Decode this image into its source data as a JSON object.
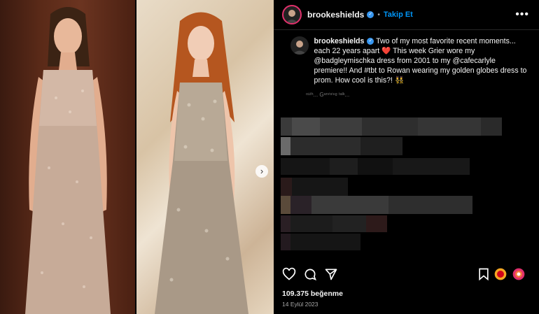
{
  "post": {
    "username": "brookeshields",
    "separator": "•",
    "follow_label": "Takip Et",
    "more_label": "•••",
    "caption_user": "brookeshields",
    "caption_line1": "Two of my most favorite recent moments... each 22 years apart",
    "caption_heart": "❤️",
    "caption_line2": "This week Grier wore my @badgleymischka dress from 2001 to my @cafecarlyle premiere!! And #tbt to Rowan wearing my golden globes dress to prom. How cool is this?!",
    "caption_emoji": "👯",
    "caption_faded": "ᵒ¹ᵗʰ... Gᵃʳᵛⁱˢⁱⁿᵍ ᵗᵃˡᵏ...",
    "likes": "109.375 beğenme",
    "date": "14 Eylül 2023"
  },
  "icons": {
    "like": "heart-icon",
    "comment": "comment-icon",
    "share": "send-icon",
    "save": "bookmark-icon",
    "next": "chevron-right-icon"
  },
  "colors": {
    "follow": "#0095f6",
    "verified": "#3897f0",
    "background": "#000000"
  }
}
